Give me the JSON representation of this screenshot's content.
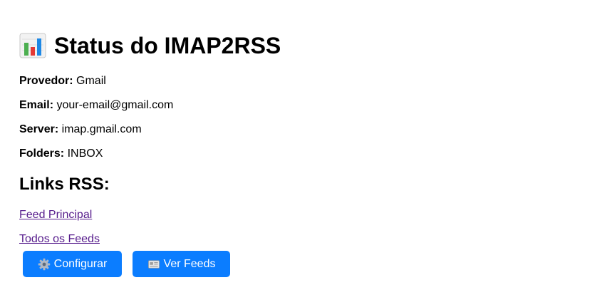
{
  "header": {
    "title_icon": "bar-chart-icon",
    "title": "Status do IMAP2RSS"
  },
  "info": {
    "provider_label": "Provedor:",
    "provider_value": "Gmail",
    "email_label": "Email:",
    "email_value": "your-email@gmail.com",
    "server_label": "Server:",
    "server_value": "imap.gmail.com",
    "folders_label": "Folders:",
    "folders_value": "INBOX"
  },
  "links_section": {
    "title": "Links RSS:",
    "feed_principal": "Feed Principal",
    "todos_feeds": "Todos os Feeds"
  },
  "buttons": {
    "config_icon": "gear-icon",
    "config_label": "Configurar",
    "feeds_icon": "newspaper-icon",
    "feeds_label": "Ver Feeds"
  },
  "colors": {
    "button_bg": "#0b7dff",
    "link_visited": "#551a8b"
  }
}
